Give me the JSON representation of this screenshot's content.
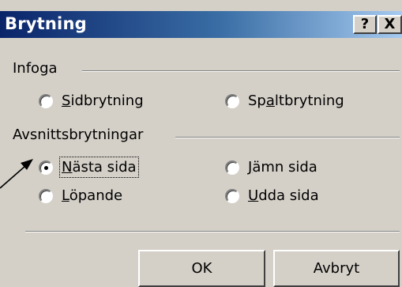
{
  "dialog": {
    "title": "Brytning",
    "help_label": "?",
    "close_label": "X"
  },
  "infoga": {
    "label": "Infoga",
    "options": [
      {
        "pre": "",
        "key": "S",
        "post": "idbrytning",
        "selected": false
      },
      {
        "pre": "Sp",
        "key": "a",
        "post": "ltbrytning",
        "selected": false
      }
    ]
  },
  "avsnitt": {
    "label": "Avsnittsbrytningar",
    "options": [
      {
        "pre": "",
        "key": "N",
        "post": "ästa sida",
        "selected": true
      },
      {
        "pre": "",
        "key": "J",
        "post": "ämn sida",
        "selected": false
      },
      {
        "pre": "",
        "key": "L",
        "post": "öpande",
        "selected": false
      },
      {
        "pre": "",
        "key": "U",
        "post": "dda sida",
        "selected": false
      }
    ]
  },
  "buttons": {
    "ok_label": "OK",
    "cancel_label": "Avbryt"
  }
}
